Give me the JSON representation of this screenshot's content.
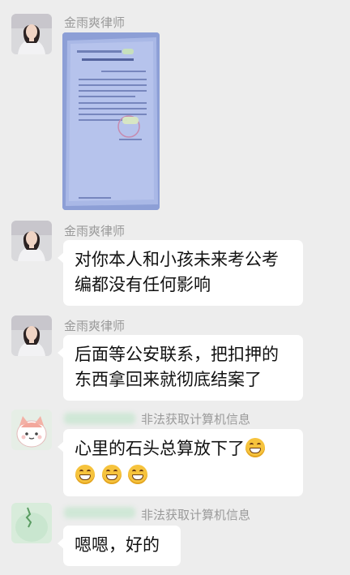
{
  "messages": [
    {
      "sender": "金雨爽律师",
      "type": "image",
      "image": {
        "header_text": "日照市公安局",
        "title": "解除取保候审决定书"
      }
    },
    {
      "sender": "金雨爽律师",
      "type": "text",
      "lines": [
        "对你本人和小孩未来考公考",
        "编都没有任何影响"
      ]
    },
    {
      "sender": "金雨爽律师",
      "type": "text",
      "lines": [
        "后面等公安联系，把扣押的",
        "东西拿回来就彻底结案了"
      ]
    },
    {
      "sender_suffix": "非法获取计算机信息",
      "type": "text",
      "line1": "心里的石头总算放下了",
      "emojis": [
        "grinning-emoji",
        "grinning-emoji",
        "grinning-emoji",
        "grinning-emoji"
      ]
    },
    {
      "sender_suffix": "非法获取计算机信息",
      "type": "text",
      "text": "嗯嗯，好的"
    }
  ],
  "colors": {
    "background": "#ededed",
    "bubble": "#ffffff",
    "sender": "#9a9a9a",
    "text": "#111111"
  }
}
